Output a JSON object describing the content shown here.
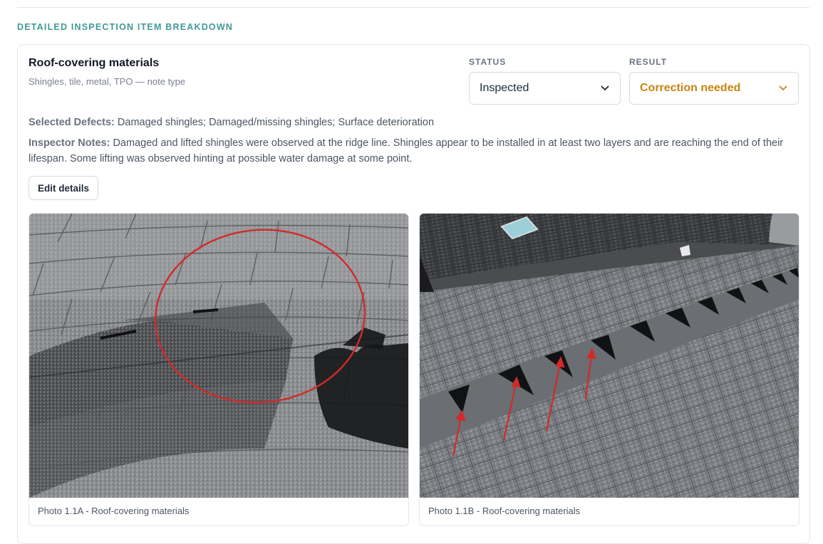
{
  "section": {
    "heading": "DETAILED INSPECTION ITEM BREAKDOWN"
  },
  "item": {
    "title": "Roof-covering materials",
    "subtitle": "Shingles, tile, metal, TPO — note type",
    "status_label": "STATUS",
    "status_value": "Inspected",
    "result_label": "RESULT",
    "result_value": "Correction needed",
    "defects_label": "Selected Defects:",
    "defects_value": "Damaged shingles; Damaged/missing shingles; Surface deterioration",
    "notes_label": "Inspector Notes:",
    "notes_value": "Damaged and lifted shingles were observed at the ridge line. Shingles appear to be installed in at least two layers and are reaching the end of their lifespan. Some lifting was observed hinting at possible water damage at some point.",
    "edit_button": "Edit details"
  },
  "photos": [
    {
      "caption": "Photo 1.1A - Roof-covering materials"
    },
    {
      "caption": "Photo 1.1B - Roof-covering materials"
    }
  ],
  "colors": {
    "accent_teal": "#3f9a96",
    "result_orange": "#c88412",
    "annotation_red": "#d22a2a"
  }
}
